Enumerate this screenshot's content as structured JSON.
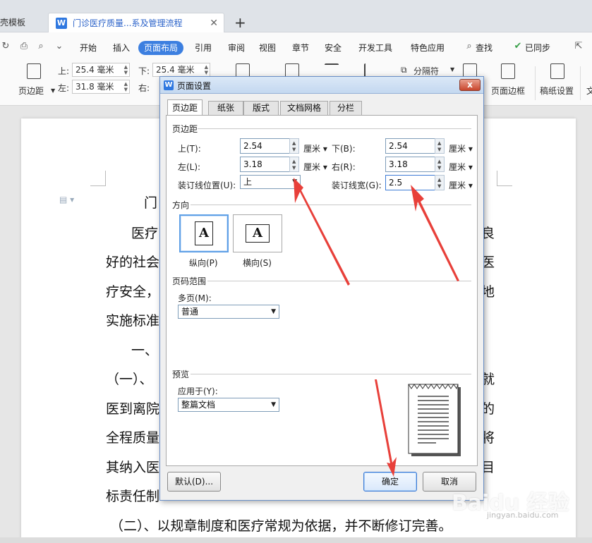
{
  "tabs": {
    "prev_tab": "壳模板",
    "active_tab": "门诊医疗质量...系及管理流程",
    "active_icon": "W",
    "close": "✕",
    "add": "+"
  },
  "menu": {
    "items": [
      "开始",
      "插入",
      "页面布局",
      "引用",
      "审阅",
      "视图",
      "章节",
      "安全",
      "开发工具",
      "特色应用"
    ],
    "active_index": 2,
    "search": "查找",
    "sync": "已同步"
  },
  "ribbon": {
    "margin_button": "页边距",
    "top_label": "上:",
    "top_value": "25.4 毫米",
    "bottom_label": "下:",
    "bottom_value": "25.4 毫米",
    "left_label": "左:",
    "left_value": "31.8 毫米",
    "right_label": "右:",
    "separator_button": "分隔符",
    "page_border": "页面边框",
    "draft_settings": "稿纸设置",
    "more": "文"
  },
  "document": {
    "title_frag": "门",
    "lines": [
      {
        "left": "医疗",
        "right": "良"
      },
      {
        "left": "好的社会",
        "right": "医"
      },
      {
        "left": "疗安全，",
        "right": "地"
      },
      {
        "left": "实施标准",
        "right": ""
      },
      {
        "left": "一、",
        "right": ""
      },
      {
        "left": "（一）、",
        "right": "就"
      },
      {
        "left": "医到离院",
        "right": "的"
      },
      {
        "left": "全程质量",
        "right": "将"
      },
      {
        "left": "其纳入医",
        "right": "目"
      },
      {
        "left": "标责任制",
        "right": ""
      }
    ],
    "last_line": "（二）、以规章制度和医疗常规为依据，并不断修订完善。"
  },
  "dialog": {
    "title": "页面设置",
    "title_icon": "W",
    "close": "x",
    "tabs": [
      "页边距",
      "纸张",
      "版式",
      "文档网格",
      "分栏"
    ],
    "active_tab": 0,
    "margins_section": "页边距",
    "top_label": "上(T):",
    "top_value": "2.54",
    "bottom_label": "下(B):",
    "bottom_value": "2.54",
    "left_label": "左(L):",
    "left_value": "3.18",
    "right_label": "右(R):",
    "right_value": "3.18",
    "gutter_pos_label": "装订线位置(U):",
    "gutter_pos_value": "上",
    "gutter_width_label": "装订线宽(G):",
    "gutter_width_value": "2.5",
    "unit": "厘米",
    "orientation_section": "方向",
    "portrait": "纵向(P)",
    "landscape": "横向(S)",
    "orient_glyph": "A",
    "pages_section": "页码范围",
    "multi_label": "多页(M):",
    "multi_value": "普通",
    "preview_section": "预览",
    "apply_label": "应用于(Y):",
    "apply_value": "整篇文档",
    "default_button": "默认(D)...",
    "ok_button": "确定",
    "cancel_button": "取消"
  },
  "watermark": {
    "text": "Baidu 经验",
    "sub": "jingyan.baidu.com"
  },
  "colors": {
    "accent": "#3c7fe0",
    "arrow": "#e8403a"
  }
}
